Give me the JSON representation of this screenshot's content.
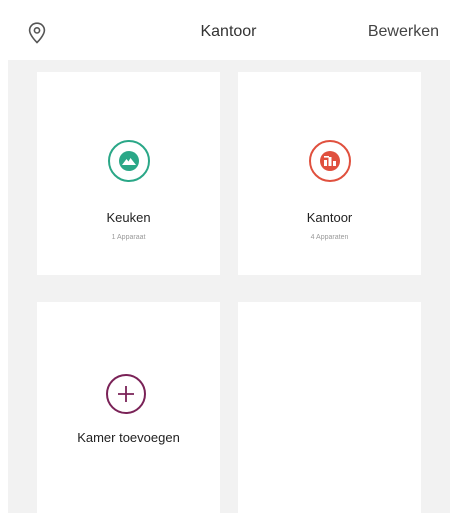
{
  "header": {
    "title": "Kantoor",
    "edit_label": "Bewerken",
    "location_icon": "location-pin-icon"
  },
  "rooms": [
    {
      "name": "Keuken",
      "count": "1 Apparaat",
      "icon": "mountain-icon",
      "color": "#2aa787"
    },
    {
      "name": "Kantoor",
      "count": "4 Apparaten",
      "icon": "office-icon",
      "color": "#e0503e"
    }
  ],
  "add_room": {
    "label": "Kamer toevoegen",
    "icon": "plus-icon",
    "color": "#7a2257"
  }
}
